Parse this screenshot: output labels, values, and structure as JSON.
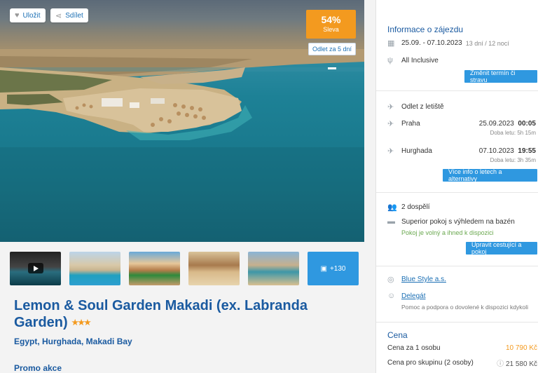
{
  "actions": {
    "save_label": "Uložit",
    "share_label": "Sdílet"
  },
  "discount": {
    "percent": "54%",
    "label": "Sleva"
  },
  "departure_badge": "Odlet za 5 dní",
  "gallery": {
    "more_label": "+130"
  },
  "hotel": {
    "name": "Lemon & Soul Garden Makadi (ex. Labranda Garden)",
    "stars": "★★★",
    "location": "Egypt, Hurghada, Makadi Bay",
    "promo_label": "Promo akce"
  },
  "trip_info": {
    "title": "Informace o zájezdu",
    "dates": "25.09. - 07.10.2023",
    "duration": "13 dní / 12 nocí",
    "board": "All Inclusive",
    "change_button": "Změnit termín či stravu"
  },
  "flights": {
    "title": "Odlet z letiště",
    "outbound": {
      "city": "Praha",
      "date": "25.09.2023",
      "time": "00:05",
      "duration": "Doba letu: 5h 15m"
    },
    "return": {
      "city": "Hurghada",
      "date": "07.10.2023",
      "time": "19:55",
      "duration": "Doba letu: 3h 35m"
    },
    "more_button": "Více info o letech a alternativy"
  },
  "travellers": {
    "count": "2 dospělí",
    "room": "Superior pokoj s výhledem na bazén",
    "availability": "Pokoj je volný a ihned k dispozici",
    "edit_button": "Upravit cestující a pokoj"
  },
  "agency": {
    "operator": "Blue Style a.s.",
    "delegate": "Delegát",
    "delegate_note": "Pomoc a podpora o dovolené k dispozici kdykoli"
  },
  "price": {
    "title": "Cena",
    "per_person_label": "Cena za 1 osobu",
    "per_person_value": "10 790 Kč",
    "group_label": "Cena pro skupinu (2 osoby)",
    "group_value": "21 580 Kč"
  }
}
